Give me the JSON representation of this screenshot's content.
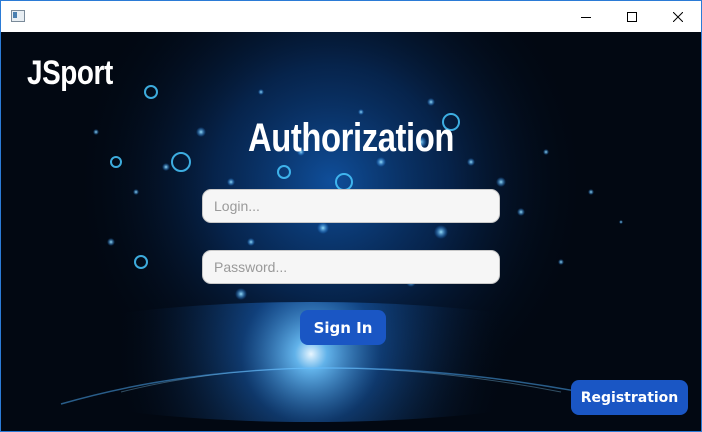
{
  "window": {
    "controls": {
      "minimize_icon": "minimize-icon",
      "maximize_icon": "maximize-icon",
      "close_icon": "close-icon"
    }
  },
  "brand": "JSport",
  "title": "Authorization",
  "form": {
    "login": {
      "value": "",
      "placeholder": "Login..."
    },
    "password": {
      "value": "",
      "placeholder": "Password..."
    },
    "sign_in_label": "Sign In"
  },
  "registration_label": "Registration",
  "colors": {
    "button": "#1a56c4",
    "background": "#020812",
    "glow": "#1e8cff",
    "input_bg": "#f6f6f6"
  }
}
